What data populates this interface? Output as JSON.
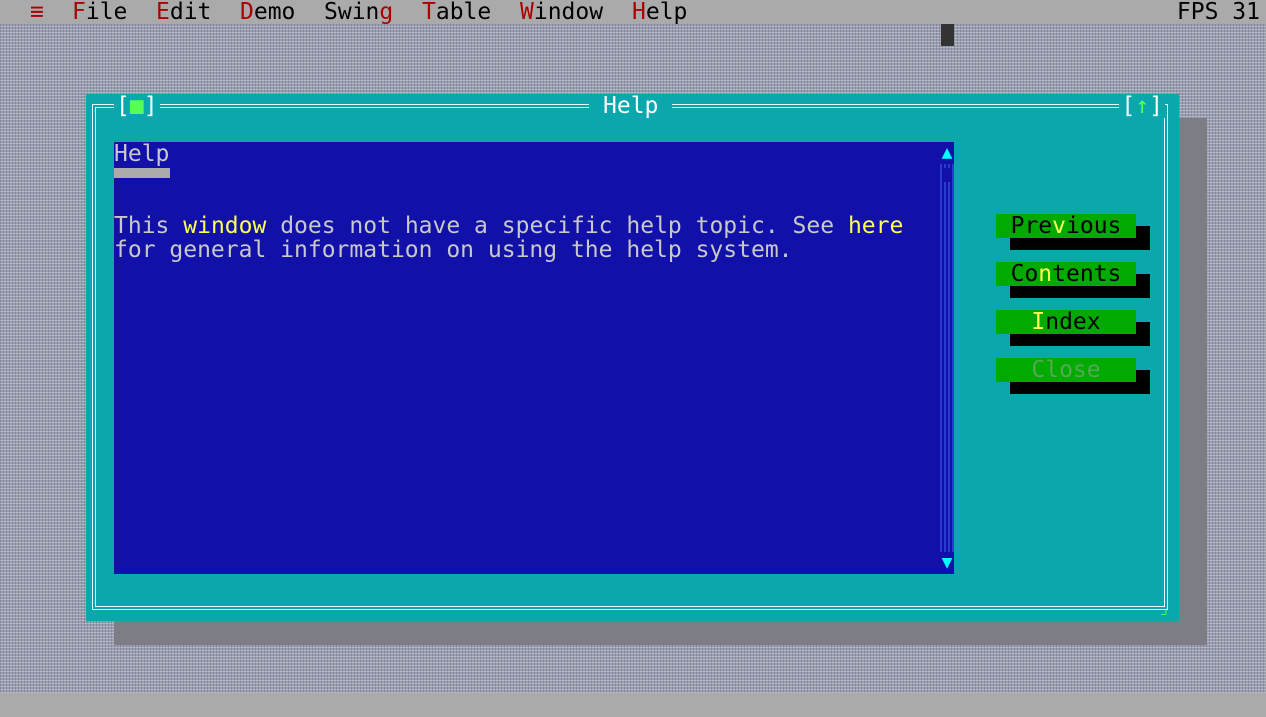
{
  "menubar": {
    "system_icon": "≡",
    "items": [
      {
        "hot": "F",
        "rest": "ile"
      },
      {
        "hot": "E",
        "rest": "dit"
      },
      {
        "hot": "D",
        "rest": "emo"
      },
      {
        "hot": "",
        "pre": "Swin",
        "hot2": "g",
        "rest": ""
      },
      {
        "hot": "T",
        "rest": "able"
      },
      {
        "hot": "W",
        "rest": "indow"
      },
      {
        "hot": "H",
        "rest": "elp"
      }
    ],
    "fps": "FPS 31"
  },
  "window": {
    "title": "Help",
    "close_left": "[",
    "close_icon": "■",
    "close_right": "]",
    "zoom_left": "[",
    "zoom_icon": "↑",
    "zoom_right": "]"
  },
  "content": {
    "heading": "Help",
    "line1_a": "This ",
    "line1_link": "window",
    "line1_b": " does not have a specific help topic. See ",
    "line1_link2": "here",
    "line2": "for general information on using the help system."
  },
  "buttons": {
    "previous_pre": "Pre",
    "previous_hk": "v",
    "previous_post": "ious",
    "contents_pre": "Co",
    "contents_hk": "n",
    "contents_post": "tents",
    "index_pre": "",
    "index_hk": "I",
    "index_post": "ndex",
    "close": "Close"
  },
  "colors": {
    "desktop": "#9a9ead",
    "window": "#0aa8ad",
    "content_bg": "#1111aa",
    "link": "#ffff55",
    "button": "#00aa00",
    "menu_hotkey": "#aa0000"
  }
}
